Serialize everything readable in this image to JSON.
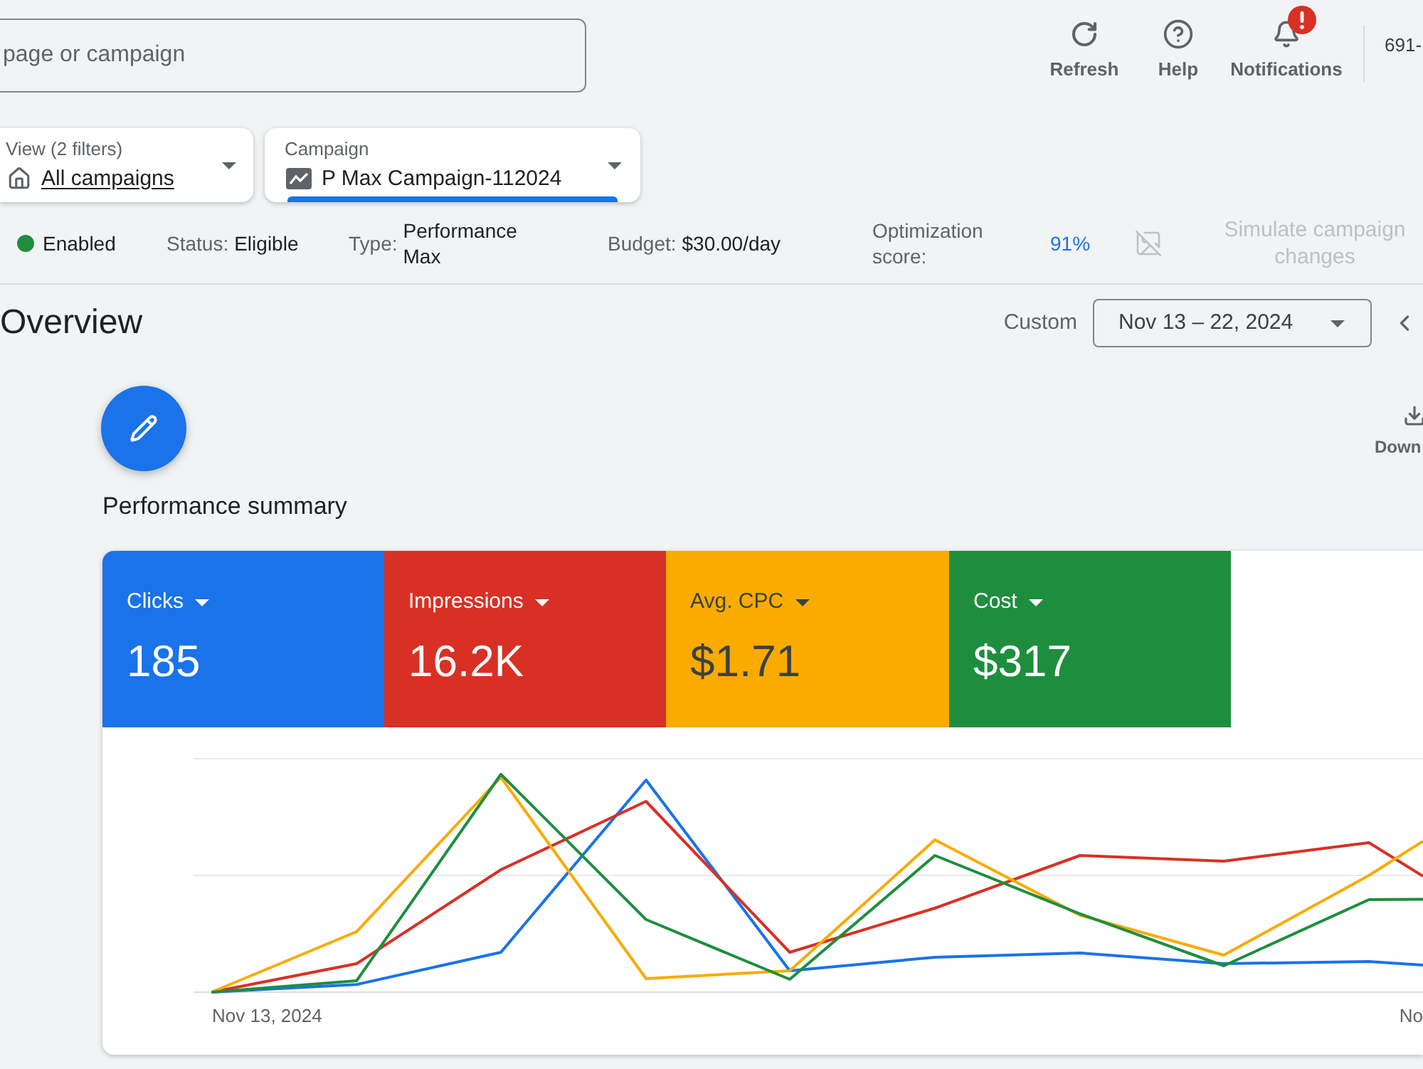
{
  "header": {
    "search": {
      "placeholder": "page or campaign"
    },
    "actions": [
      {
        "kind": "refresh",
        "label": "Refresh",
        "alert": false
      },
      {
        "kind": "help",
        "label": "Help",
        "alert": false
      },
      {
        "kind": "notifications",
        "label": "Notifications",
        "alert": true
      }
    ],
    "account": "691-"
  },
  "filters": [
    {
      "kind": "view",
      "label": "View (2 filters)",
      "value": "All campaigns",
      "selected": false
    },
    {
      "kind": "campaign",
      "label": "Campaign",
      "value": "P Max Campaign-112024",
      "selected": true
    }
  ],
  "status_bar": {
    "state": "Enabled",
    "items": [
      {
        "label": "Status:",
        "value": "Eligible"
      },
      {
        "label": "Type:",
        "value": "Performance Max"
      },
      {
        "label": "Budget:",
        "value": "$30.00/day"
      }
    ],
    "optimization": {
      "label": "Optimization score:",
      "value": "91%"
    },
    "simulate": {
      "label": "Simulate campaign changes",
      "disabled": true
    }
  },
  "overview": {
    "title": "Overview",
    "date_label": "Custom",
    "date_range": "Nov 13 – 22, 2024",
    "download": "Down"
  },
  "performance_summary": {
    "title": "Performance summary",
    "metrics": [
      {
        "label": "Clicks",
        "value": "185",
        "color": "#1a73e8",
        "selected": true
      },
      {
        "label": "Impressions",
        "value": "16.2K",
        "color": "#d93025",
        "selected": true
      },
      {
        "label": "Avg. CPC",
        "value": "$1.71",
        "color": "#f9ab00",
        "selected": true
      },
      {
        "label": "Cost",
        "value": "$317",
        "color": "#1e8e3e",
        "selected": true
      }
    ],
    "chart": {
      "x_labels": [
        "Nov 13, 2024",
        "No"
      ]
    }
  }
}
